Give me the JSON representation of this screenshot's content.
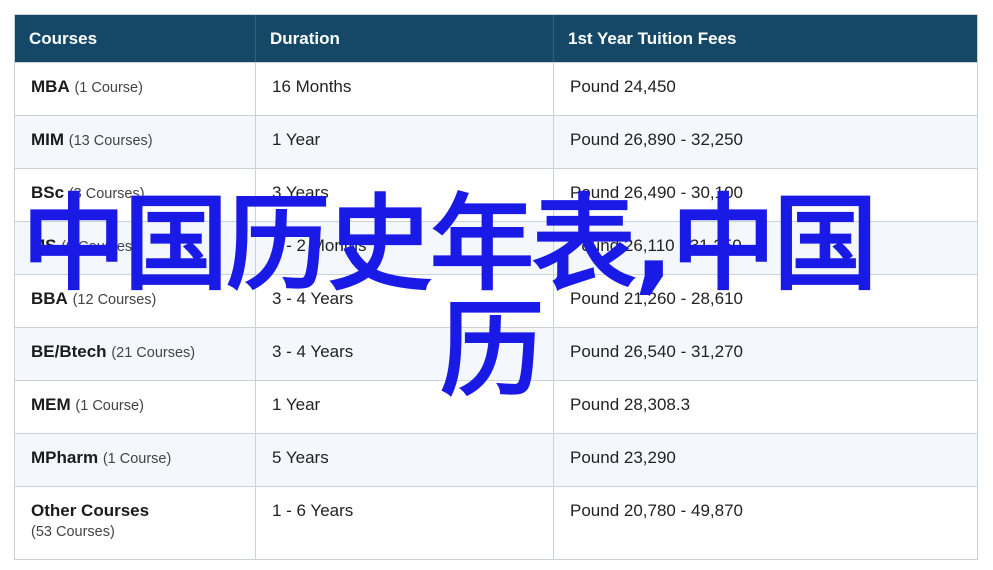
{
  "table": {
    "headers": [
      "Courses",
      "Duration",
      "1st Year Tuition Fees"
    ],
    "rows": [
      {
        "name": "MBA",
        "count": "(1 Course)",
        "duration": "16 Months",
        "fee": "Pound 24,450"
      },
      {
        "name": "MIM",
        "count": "(13 Courses)",
        "duration": "1 Year",
        "fee": "Pound 26,890 - 32,250"
      },
      {
        "name": "BSc",
        "count": "(3 Courses)",
        "duration": "3 Years",
        "fee": "Pound 26,490 - 30,100"
      },
      {
        "name": "MS",
        "count": "(9 Courses)",
        "duration": "1 - 2 Months",
        "fee": "Pound 26,110 - 31,250"
      },
      {
        "name": "BBA",
        "count": "(12 Courses)",
        "duration": "3 - 4 Years",
        "fee": "Pound 21,260 - 28,610"
      },
      {
        "name": "BE/Btech",
        "count": "(21 Courses)",
        "duration": "3 - 4 Years",
        "fee": "Pound 26,540 - 31,270"
      },
      {
        "name": "MEM",
        "count": "(1 Course)",
        "duration": "1 Year",
        "fee": "Pound 28,308.3"
      },
      {
        "name": "MPharm",
        "count": "(1 Course)",
        "duration": "5 Years",
        "fee": "Pound 23,290"
      },
      {
        "name": "Other Courses",
        "count": "(53 Courses)",
        "duration": "1 - 6 Years",
        "fee": "Pound 20,780 - 49,870"
      }
    ]
  },
  "watermark": {
    "line1": "中国历史年表,中国",
    "line2": "历",
    "color": "#1a1ae6"
  },
  "colors": {
    "header_bg": "#154866",
    "row_alt_bg": "#f4f8fc",
    "border": "#c9d3dc"
  }
}
